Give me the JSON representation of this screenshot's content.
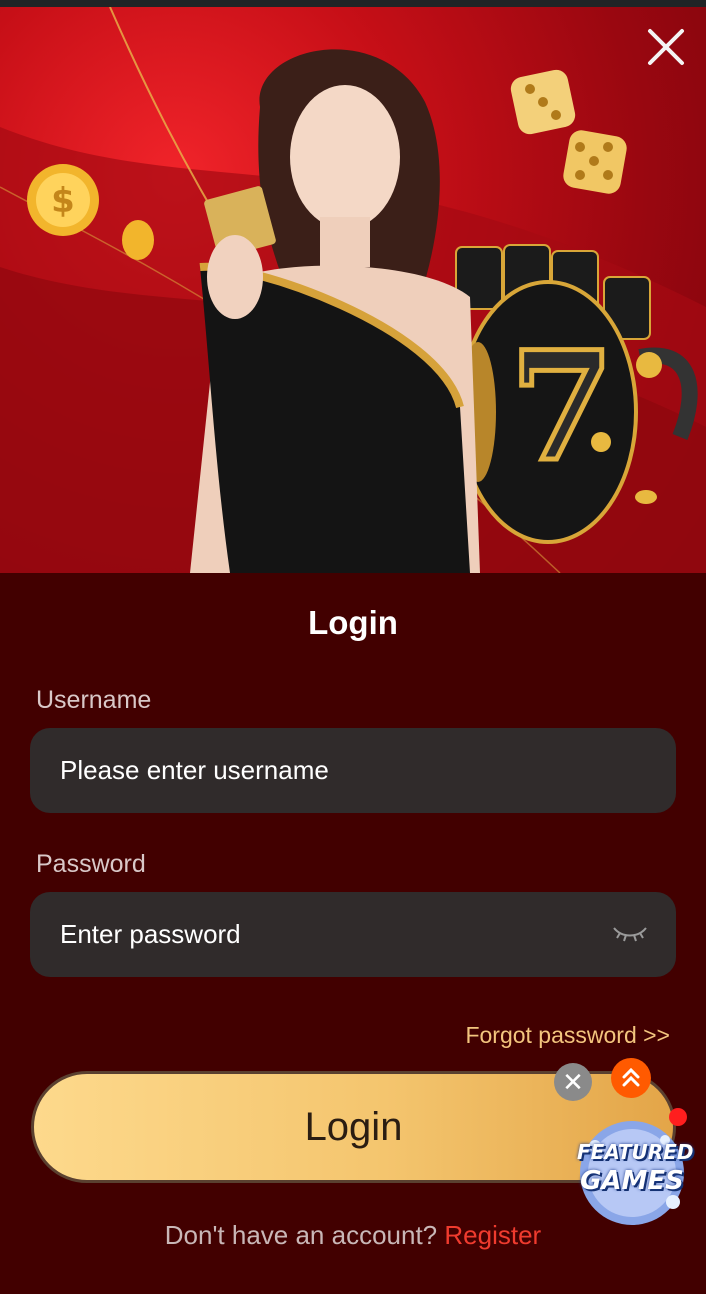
{
  "banner": {
    "close_icon": "close-icon",
    "colors": {
      "background": "#c70f17",
      "accent_gold": "#f2c04a"
    }
  },
  "form": {
    "title": "Login",
    "username": {
      "label": "Username",
      "placeholder": "Please enter username",
      "value": ""
    },
    "password": {
      "label": "Password",
      "placeholder": "Enter password",
      "value": "",
      "toggle_icon": "eye-closed-icon"
    },
    "forgot_link": "Forgot password >>",
    "submit_label": "Login",
    "no_account_text": "Don't have an account?",
    "register_link": "Register"
  },
  "floating": {
    "close_label": "✕",
    "up_icon": "double-chevron-up-icon",
    "badge_line1": "FEATURED",
    "badge_line2": "GAMES"
  },
  "colors": {
    "page_bg": "#420000",
    "input_bg": "#302b2b",
    "forgot": "#f3c57e",
    "register": "#ef3b2e",
    "button_gold": "#f4c56e"
  }
}
